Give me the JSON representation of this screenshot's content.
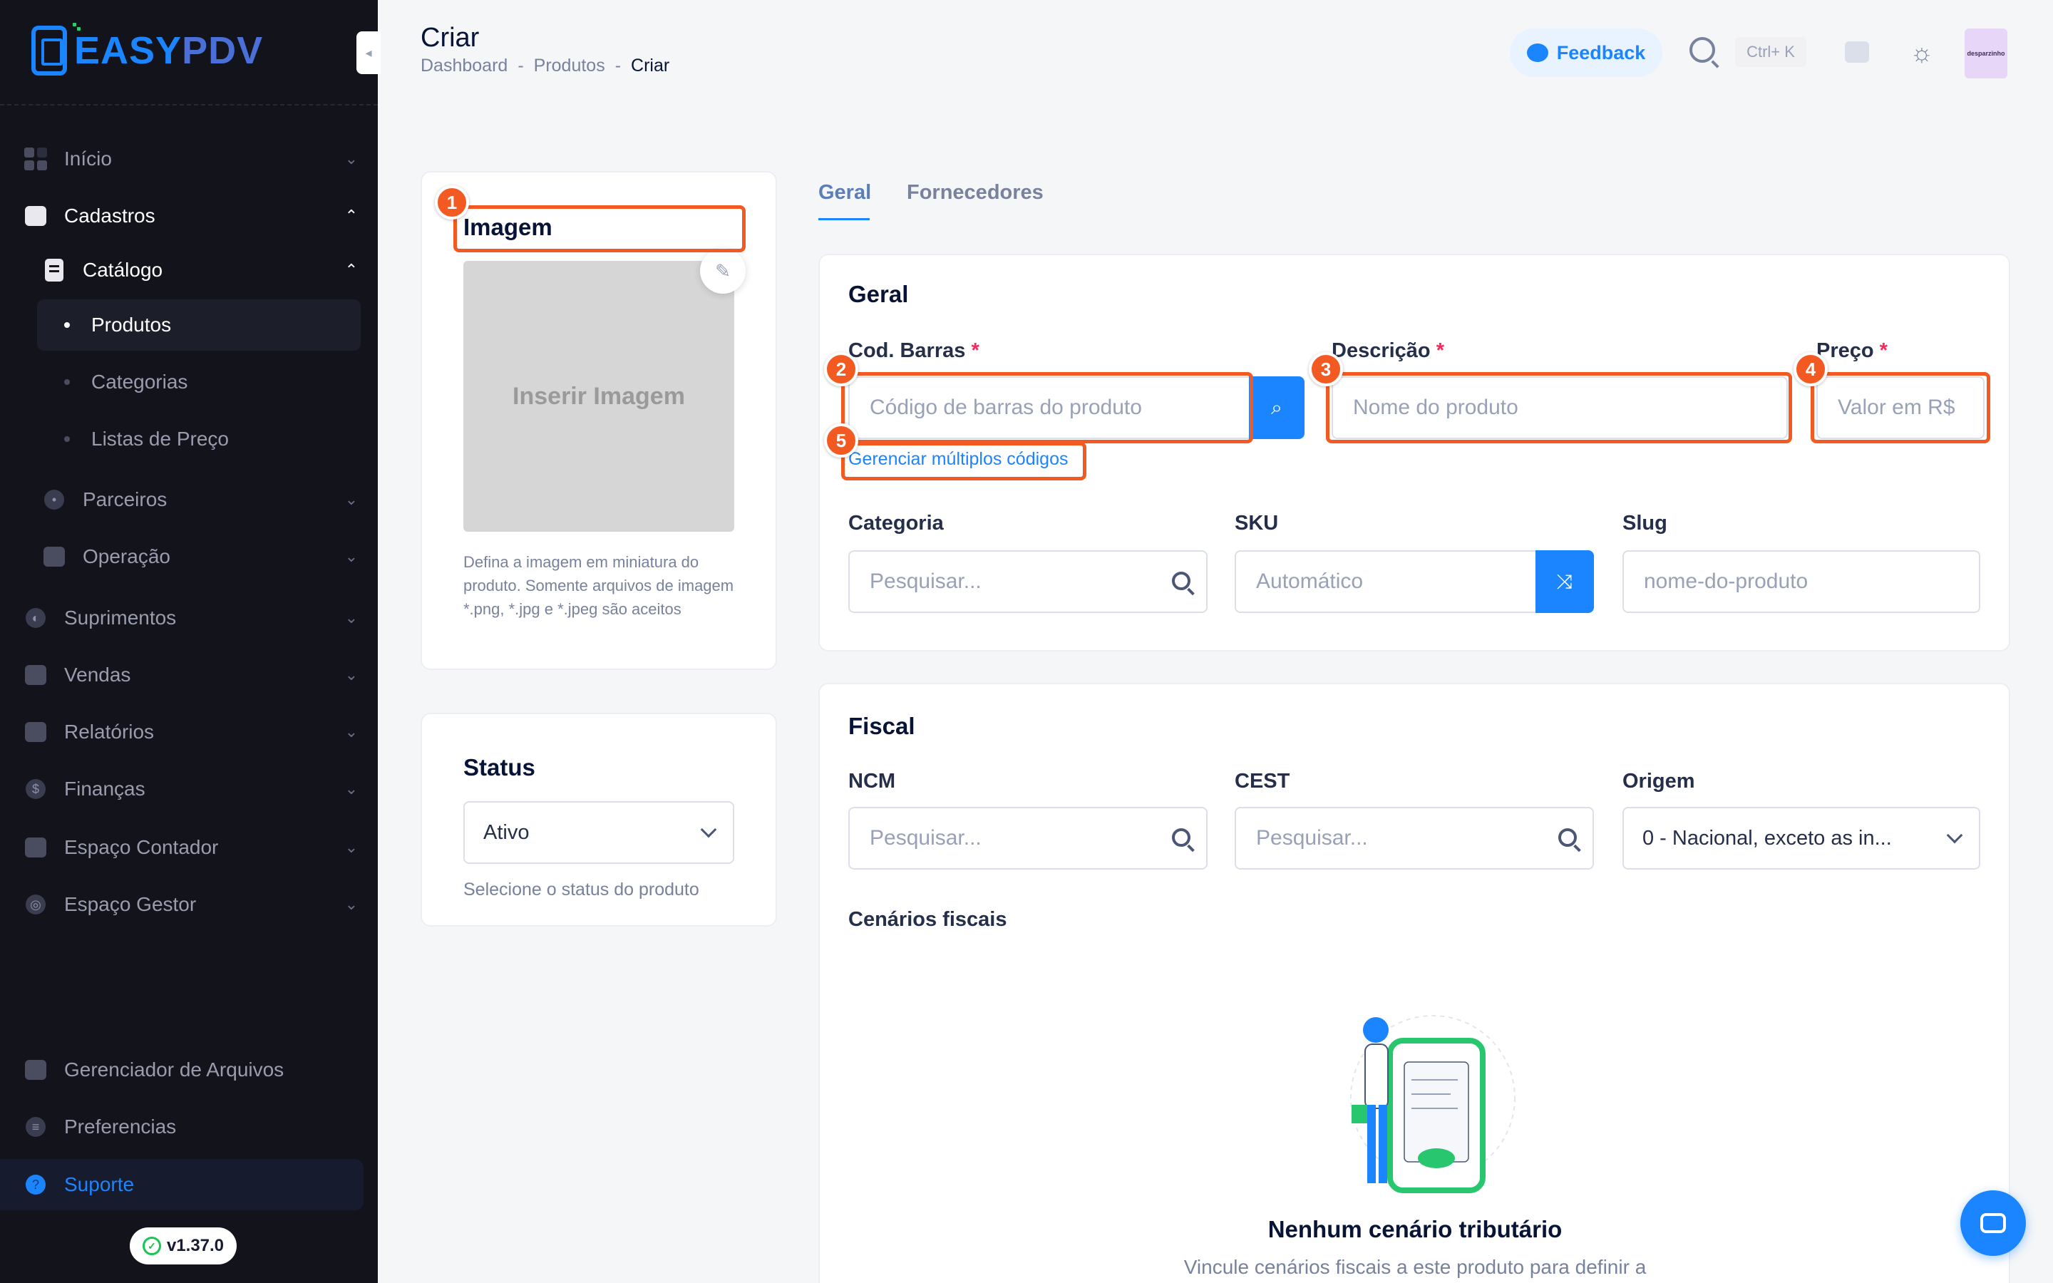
{
  "brand": {
    "logo_a": "EASY",
    "logo_b": "PDV"
  },
  "sidebar": {
    "items": [
      {
        "label": "Início",
        "icon": "grid-icon"
      },
      {
        "label": "Cadastros",
        "icon": "id-card-icon"
      },
      {
        "label": "Catálogo",
        "icon": "document-icon"
      },
      {
        "label": "Parceiros",
        "icon": "people-icon"
      },
      {
        "label": "Operação",
        "icon": "box-icon"
      },
      {
        "label": "Suprimentos",
        "icon": "truck-icon"
      },
      {
        "label": "Vendas",
        "icon": "calendar-icon"
      },
      {
        "label": "Relatórios",
        "icon": "chart-icon"
      },
      {
        "label": "Finanças",
        "icon": "dollar-icon"
      },
      {
        "label": "Espaço Contador",
        "icon": "calculator-icon"
      },
      {
        "label": "Espaço Gestor",
        "icon": "manager-icon"
      },
      {
        "label": "Gerenciador de Arquivos",
        "icon": "folder-icon"
      },
      {
        "label": "Preferencias",
        "icon": "sliders-icon"
      }
    ],
    "catalog_sub": [
      {
        "label": "Produtos"
      },
      {
        "label": "Categorias"
      },
      {
        "label": "Listas de Preço"
      }
    ],
    "support": "Suporte",
    "version": "v1.37.0"
  },
  "header": {
    "title": "Criar",
    "breadcrumb": [
      "Dashboard",
      "-",
      "Produtos",
      "-",
      "Criar"
    ],
    "feedback": "Feedback",
    "shortcut": "Ctrl+ K",
    "avatar_text": "desparzinho"
  },
  "image_card": {
    "title": "Imagem",
    "placeholder": "Inserir Imagem",
    "hint": "Defina a imagem em miniatura do produto. Somente arquivos de imagem *.png, *.jpg e *.jpeg são aceitos"
  },
  "status_card": {
    "title": "Status",
    "value": "Ativo",
    "hint": "Selecione o status do produto"
  },
  "tabs": [
    "Geral",
    "Fornecedores"
  ],
  "geral": {
    "title": "Geral",
    "barcode_label": "Cod. Barras",
    "barcode_placeholder": "Código de barras do produto",
    "manage_codes": "Gerenciar múltiplos códigos",
    "desc_label": "Descrição",
    "desc_placeholder": "Nome do produto",
    "price_label": "Preço",
    "price_placeholder": "Valor em R$",
    "required": "*",
    "category_label": "Categoria",
    "category_placeholder": "Pesquisar...",
    "sku_label": "SKU",
    "sku_placeholder": "Automático",
    "slug_label": "Slug",
    "slug_placeholder": "nome-do-produto"
  },
  "fiscal": {
    "title": "Fiscal",
    "ncm_label": "NCM",
    "ncm_placeholder": "Pesquisar...",
    "cest_label": "CEST",
    "cest_placeholder": "Pesquisar...",
    "origin_label": "Origem",
    "origin_value": "0 - Nacional, exceto as in...",
    "scenarios_label": "Cenários fiscais",
    "empty_title": "Nenhum cenário tributário",
    "empty_sub": "Vincule cenários fiscais a este produto para definir a"
  },
  "annotations": [
    "1",
    "2",
    "3",
    "4",
    "5"
  ],
  "colors": {
    "accent": "#1b84ff",
    "highlight": "#f25a22",
    "sidebar": "#12131b",
    "required": "#f8285a"
  }
}
